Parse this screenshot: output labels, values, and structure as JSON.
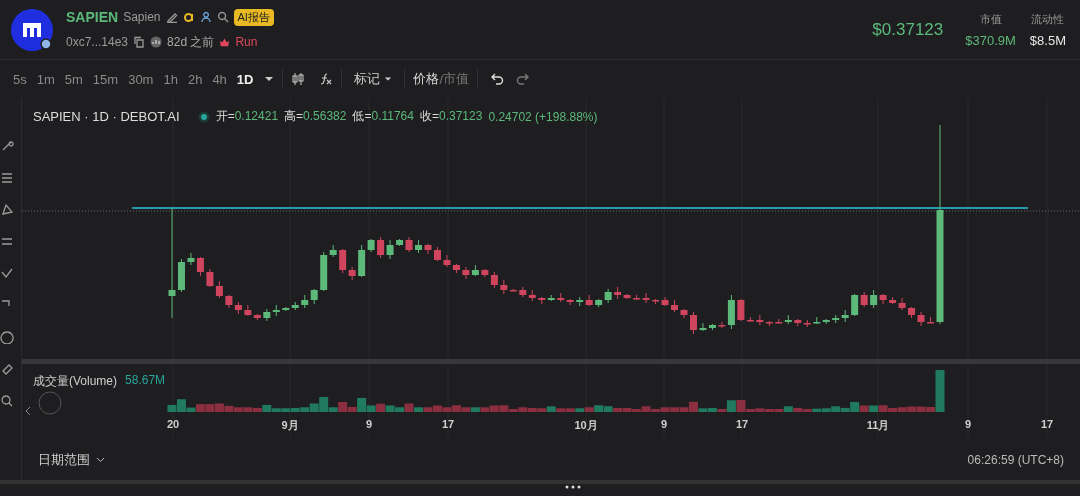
{
  "header": {
    "symbol": "SAPIEN",
    "name": "Sapien",
    "badge": "AI报告",
    "address": "0xc7...14e3",
    "age": "82d 之前",
    "tag": "Run",
    "price": "$0.37123",
    "stats": [
      {
        "label": "市值",
        "value": "$370.9M",
        "kind": "positive"
      },
      {
        "label": "流动性",
        "value": "$8.5M",
        "kind": "neutral"
      }
    ]
  },
  "toolbar": {
    "intervals": [
      {
        "label": "5s",
        "selected": false
      },
      {
        "label": "1m",
        "selected": false
      },
      {
        "label": "5m",
        "selected": false
      },
      {
        "label": "15m",
        "selected": false
      },
      {
        "label": "30m",
        "selected": false
      },
      {
        "label": "1h",
        "selected": false
      },
      {
        "label": "2h",
        "selected": false
      },
      {
        "label": "4h",
        "selected": false
      },
      {
        "label": "1D",
        "selected": true
      }
    ],
    "mark_menu": "标记",
    "price_toggle": [
      {
        "label": "价格",
        "selected": true
      },
      {
        "label": "市值",
        "selected": false
      }
    ],
    "price_toggle_separator": "/"
  },
  "chart": {
    "title": "SAPIEN · 1D · DEBOT.AI",
    "ohlc": [
      {
        "label": "开=",
        "value": "0.12421"
      },
      {
        "label": "高=",
        "value": "0.56382"
      },
      {
        "label": "低=",
        "value": "0.11764"
      },
      {
        "label": "收=",
        "value": "0.37123"
      }
    ],
    "change": "0.24702 (+198.88%)",
    "volume_label": "成交量(Volume)",
    "volume_value": "58.67M",
    "x_axis_labels": [
      "20",
      "9月",
      "9",
      "17",
      "10月",
      "9",
      "17",
      "11月",
      "9",
      "17"
    ],
    "time": "06:26:59 (UTC+8)"
  },
  "footer": {
    "date_range": "日期范围"
  }
}
